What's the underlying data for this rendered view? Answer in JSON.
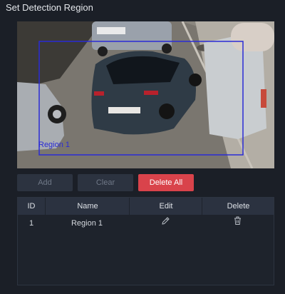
{
  "title": "Set Detection Region",
  "video": {
    "region_label": "Region 1",
    "region_color": "#2a2bd6"
  },
  "buttons": {
    "add": "Add",
    "clear": "Clear",
    "delete_all": "Delete All"
  },
  "table": {
    "headers": {
      "id": "ID",
      "name": "Name",
      "edit": "Edit",
      "delete": "Delete"
    },
    "rows": [
      {
        "id": "1",
        "name": "Region 1",
        "edit_icon": "pencil-icon",
        "delete_icon": "trash-icon"
      }
    ]
  },
  "colors": {
    "background": "#1b1f27",
    "danger": "#d9434b",
    "button_disabled": "#2c3340",
    "table_header": "#2b3240"
  }
}
